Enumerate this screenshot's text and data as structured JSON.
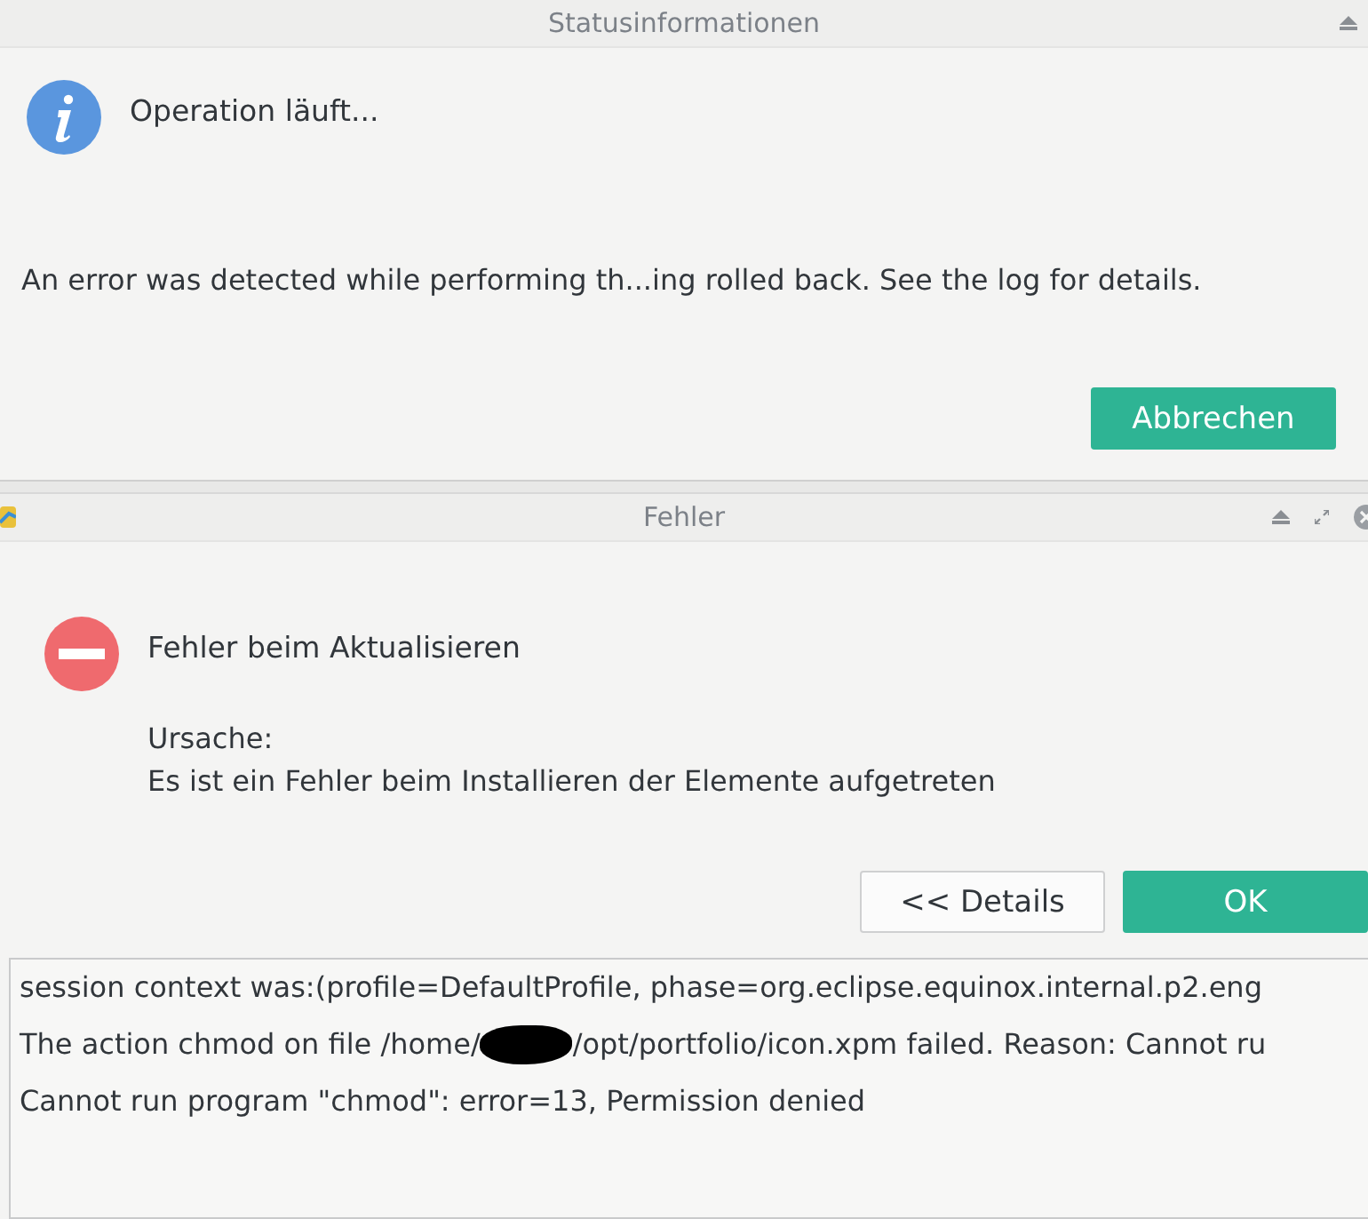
{
  "status_window": {
    "title": "Statusinformationen",
    "heading": "Operation läuft...",
    "message": "An error was detected while performing th...ing rolled back. See the log for details.",
    "buttons": [
      {
        "label": "Abbrechen",
        "kind": "primary"
      }
    ]
  },
  "error_window": {
    "title": "Fehler",
    "heading": "Fehler beim Aktualisieren",
    "reason_label": "Ursache:",
    "reason": "Es ist ein Fehler beim Installieren der Elemente aufgetreten",
    "buttons": [
      {
        "label": "<< Details",
        "kind": "secondary"
      },
      {
        "label": "OK",
        "kind": "primary"
      }
    ],
    "log_lines": [
      {
        "segments": [
          {
            "kind": "text",
            "text": "session context was:(profile=DefaultProfile, phase=org.eclipse.equinox.internal.p2.eng"
          }
        ]
      },
      {
        "segments": [
          {
            "kind": "text",
            "text": "The action chmod on file /home/"
          },
          {
            "kind": "redacted"
          },
          {
            "kind": "text",
            "text": "/opt/portfolio/icon.xpm failed. Reason: Cannot ru"
          }
        ]
      },
      {
        "segments": [
          {
            "kind": "text",
            "text": "Cannot run program \"chmod\": error=13, Permission denied"
          }
        ]
      }
    ]
  }
}
